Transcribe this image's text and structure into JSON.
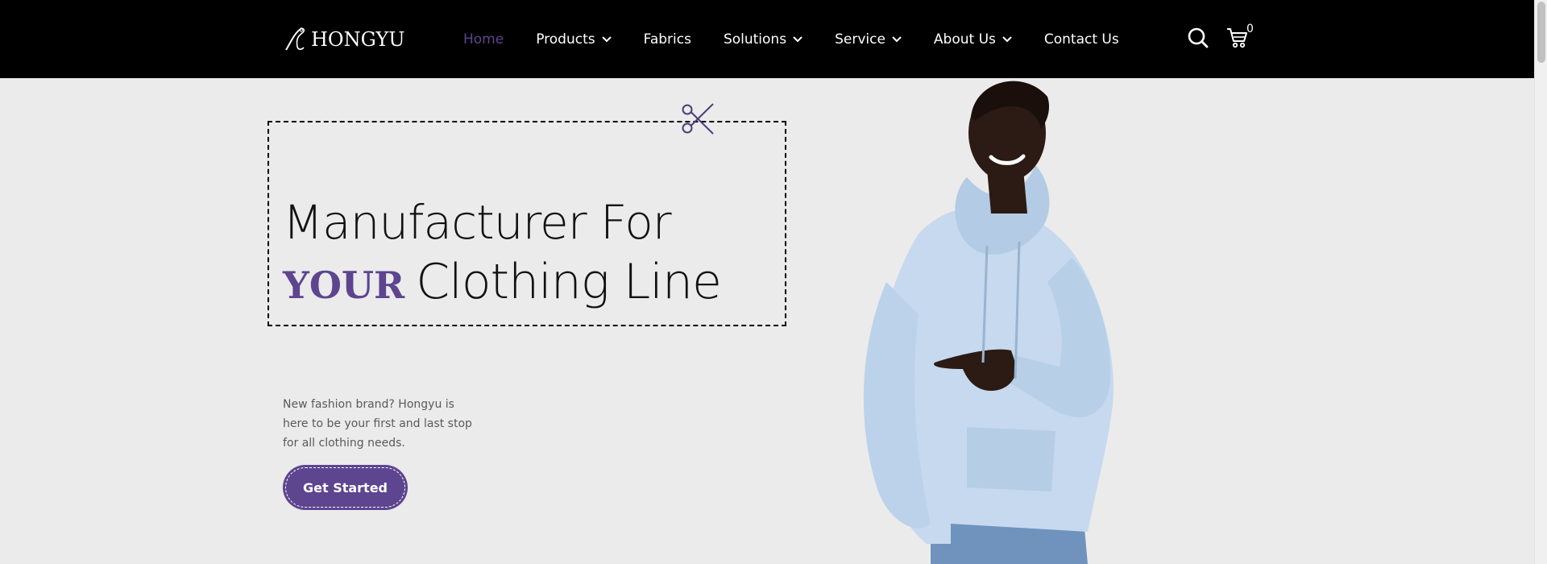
{
  "brand": {
    "name": "HONGYU"
  },
  "nav": {
    "items": [
      {
        "label": "Home",
        "active": true,
        "has_dropdown": false
      },
      {
        "label": "Products",
        "active": false,
        "has_dropdown": true
      },
      {
        "label": "Fabrics",
        "active": false,
        "has_dropdown": false
      },
      {
        "label": "Solutions",
        "active": false,
        "has_dropdown": true
      },
      {
        "label": "Service",
        "active": false,
        "has_dropdown": true
      },
      {
        "label": "About Us",
        "active": false,
        "has_dropdown": true
      },
      {
        "label": "Contact Us",
        "active": false,
        "has_dropdown": false
      }
    ]
  },
  "header_actions": {
    "search_icon": "search-icon",
    "cart_icon": "cart-icon",
    "cart_count": "0"
  },
  "hero": {
    "headline_line1": "Manufacturer For",
    "headline_accent": "YOUR",
    "headline_line2": "Clothing Line",
    "description": "New fashion brand? Hongyu is here to be your first and last stop for all clothing needs.",
    "cta_label": "Get Started",
    "decoration_icon": "scissors-icon"
  },
  "colors": {
    "accent": "#5d4590",
    "header_bg": "#000000",
    "page_bg": "#ebebeb",
    "hoodie": "#c6d9ee"
  }
}
